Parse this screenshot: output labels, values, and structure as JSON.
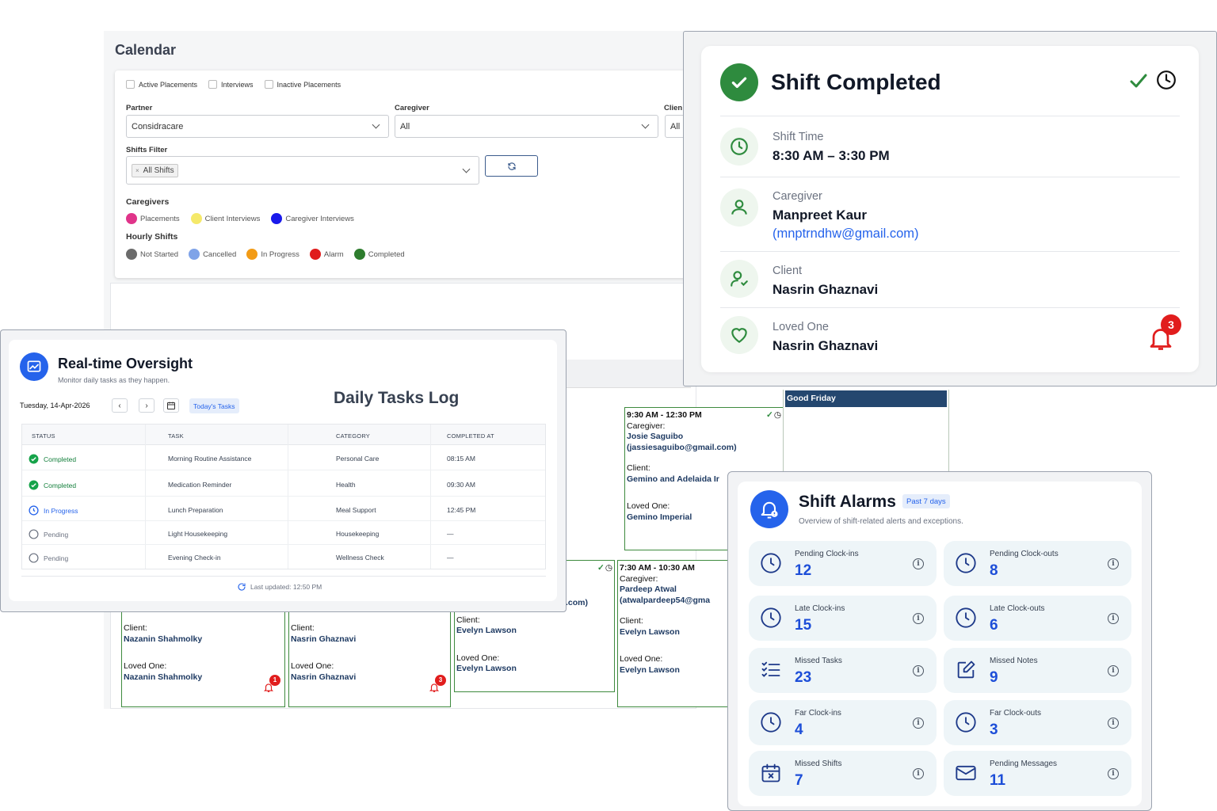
{
  "calendar": {
    "title": "Calendar",
    "checkboxes": [
      "Active Placements",
      "Interviews",
      "Inactive Placements"
    ],
    "partner": {
      "label": "Partner",
      "value": "Considracare"
    },
    "caregiver": {
      "label": "Caregiver",
      "value": "All"
    },
    "client": {
      "label": "Clien",
      "value": "All"
    },
    "shifts_filter": {
      "label": "Shifts Filter",
      "chip": "All Shifts",
      "chip_close": "×"
    },
    "caregivers_legend": {
      "title": "Caregivers",
      "items": [
        {
          "label": "Placements",
          "color": "#e0348a"
        },
        {
          "label": "Client Interviews",
          "color": "#f5e96a"
        },
        {
          "label": "Caregiver Interviews",
          "color": "#1a1aeb"
        }
      ]
    },
    "hourly_legend": {
      "title": "Hourly Shifts",
      "items": [
        {
          "label": "Not Started",
          "color": "#6b6b6b"
        },
        {
          "label": "Cancelled",
          "color": "#7fa3e8"
        },
        {
          "label": "In Progress",
          "color": "#f29b16"
        },
        {
          "label": "Alarm",
          "color": "#e01b1b"
        },
        {
          "label": "Completed",
          "color": "#2e7d2e"
        }
      ]
    },
    "holiday": "Good Friday",
    "shift_top": {
      "time": "9:30 AM - 12:30 PM",
      "caregiver_label": "Caregiver:",
      "caregiver": "Josie Saguibo",
      "caregiver_email": "(jassiesaguibo@gmail.com)",
      "client_label": "Client:",
      "client": "Gemino and Adelaida Ir",
      "loved_label": "Loved One:",
      "loved": "Gemino Imperial"
    },
    "shift_right": {
      "time": "7:30 AM - 10:30 AM",
      "caregiver_label": "Caregiver:",
      "caregiver": "Pardeep Atwal",
      "caregiver_email": "(atwalpardeep54@gma"
    },
    "partial_email": ".com)",
    "bottom_shifts": [
      {
        "client_label": "Client:",
        "client": "Nazanin Shahmolky",
        "loved_label": "Loved One:",
        "loved": "Nazanin Shahmolky",
        "badge": "1"
      },
      {
        "client_label": "Client:",
        "client": "Nasrin Ghaznavi",
        "loved_label": "Loved One:",
        "loved": "Nasrin Ghaznavi",
        "badge": "3"
      },
      {
        "client_label": "Client:",
        "client": "Evelyn Lawson",
        "loved_label": "Loved One:",
        "loved": "Evelyn Lawson",
        "badge": ""
      },
      {
        "client_label": "Client:",
        "client": "Evelyn Lawson",
        "loved_label": "Loved One:",
        "loved": "Evelyn Lawson",
        "badge": ""
      }
    ]
  },
  "shift_completed": {
    "title": "Shift Completed",
    "shift_time_label": "Shift Time",
    "shift_time": "8:30 AM – 3:30 PM",
    "caregiver_label": "Caregiver",
    "caregiver": "Manpreet Kaur",
    "caregiver_email": "(mnptrndhw@gmail.com)",
    "client_label": "Client",
    "client": "Nasrin Ghaznavi",
    "loved_label": "Loved One",
    "loved": "Nasrin Ghaznavi",
    "alarm_count": "3",
    "accent": "#2e8b3e"
  },
  "oversight": {
    "title": "Real-time Oversight",
    "subtitle": "Monitor daily tasks as they happen.",
    "date": "Tuesday, 14-Apr-2026",
    "today_button": "Today's Tasks",
    "log_title": "Daily Tasks Log",
    "columns": [
      "STATUS",
      "TASK",
      "CATEGORY",
      "COMPLETED AT"
    ],
    "rows": [
      {
        "status": "Completed",
        "kind": "done",
        "task": "Morning Routine Assistance",
        "category": "Personal Care",
        "at": "08:15 AM"
      },
      {
        "status": "Completed",
        "kind": "done",
        "task": "Medication Reminder",
        "category": "Health",
        "at": "09:30 AM"
      },
      {
        "status": "In Progress",
        "kind": "progress",
        "task": "Lunch Preparation",
        "category": "Meal Support",
        "at": "12:45 PM"
      },
      {
        "status": "Pending",
        "kind": "pending",
        "task": "Light Housekeeping",
        "category": "Housekeeping",
        "at": "—"
      },
      {
        "status": "Pending",
        "kind": "pending",
        "task": "Evening Check-in",
        "category": "Wellness Check",
        "at": "—"
      }
    ],
    "last_updated": "Last updated: 12:50 PM"
  },
  "alarms": {
    "title": "Shift Alarms",
    "period": "Past 7 days",
    "subtitle": "Overview of shift-related alerts and exceptions.",
    "tiles": [
      {
        "label": "Pending Clock-ins",
        "value": "12",
        "icon": "clock-icon"
      },
      {
        "label": "Pending Clock-outs",
        "value": "8",
        "icon": "clock-icon"
      },
      {
        "label": "Late Clock-ins",
        "value": "15",
        "icon": "clock-icon"
      },
      {
        "label": "Late Clock-outs",
        "value": "6",
        "icon": "clock-icon"
      },
      {
        "label": "Missed Tasks",
        "value": "23",
        "icon": "checklist-icon"
      },
      {
        "label": "Missed Notes",
        "value": "9",
        "icon": "edit-note-icon"
      },
      {
        "label": "Far Clock-ins",
        "value": "4",
        "icon": "clock-icon"
      },
      {
        "label": "Far Clock-outs",
        "value": "3",
        "icon": "clock-icon"
      },
      {
        "label": "Missed Shifts",
        "value": "7",
        "icon": "calendar-x-icon"
      },
      {
        "label": "Pending Messages",
        "value": "11",
        "icon": "mail-icon"
      }
    ]
  }
}
